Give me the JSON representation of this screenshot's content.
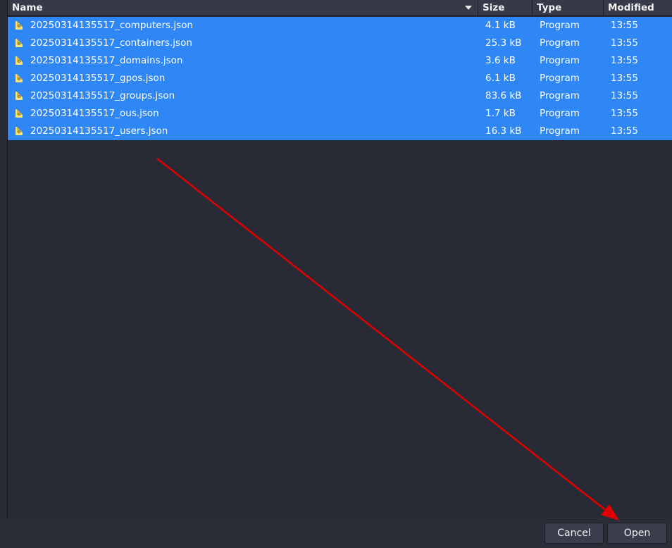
{
  "columns": {
    "name": "Name",
    "size": "Size",
    "type": "Type",
    "modified": "Modified"
  },
  "files": [
    {
      "name": "20250314135517_computers.json",
      "size": "4.1 kB",
      "type": "Program",
      "modified": "13:55"
    },
    {
      "name": "20250314135517_containers.json",
      "size": "25.3 kB",
      "type": "Program",
      "modified": "13:55"
    },
    {
      "name": "20250314135517_domains.json",
      "size": "3.6 kB",
      "type": "Program",
      "modified": "13:55"
    },
    {
      "name": "20250314135517_gpos.json",
      "size": "6.1 kB",
      "type": "Program",
      "modified": "13:55"
    },
    {
      "name": "20250314135517_groups.json",
      "size": "83.6 kB",
      "type": "Program",
      "modified": "13:55"
    },
    {
      "name": "20250314135517_ous.json",
      "size": "1.7 kB",
      "type": "Program",
      "modified": "13:55"
    },
    {
      "name": "20250314135517_users.json",
      "size": "16.3 kB",
      "type": "Program",
      "modified": "13:55"
    }
  ],
  "buttons": {
    "cancel": "Cancel",
    "open": "Open"
  },
  "colors": {
    "background": "#282a36",
    "selection": "#2f86f5",
    "header": "#363948",
    "annotation_arrow": "#e00000"
  },
  "icons": {
    "file": "text-file-icon",
    "sort": "chevron-down-icon"
  }
}
